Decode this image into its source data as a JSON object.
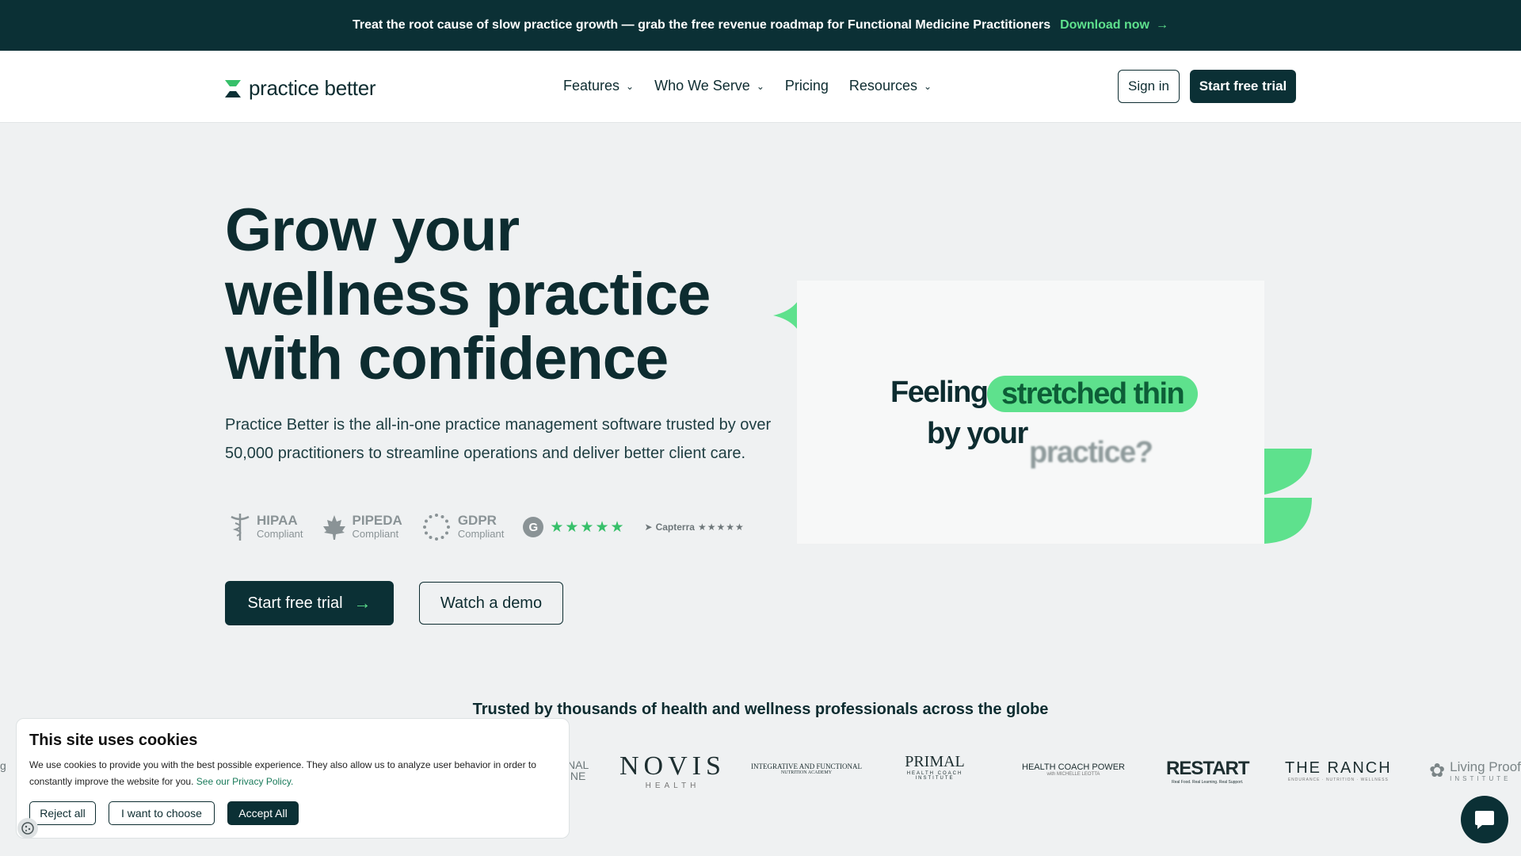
{
  "banner": {
    "text": "Treat the root cause of slow practice growth — grab the free revenue roadmap for Functional Medicine Practitioners",
    "link_label": "Download now"
  },
  "nav": {
    "logo_text": "practice better",
    "menu": [
      {
        "label": "Features",
        "has_dropdown": true
      },
      {
        "label": "Who We Serve",
        "has_dropdown": true
      },
      {
        "label": "Pricing",
        "has_dropdown": false
      },
      {
        "label": "Resources",
        "has_dropdown": true
      }
    ],
    "sign_in": "Sign in",
    "start_trial": "Start free trial"
  },
  "hero": {
    "title_line1": "Grow your",
    "title_line2": "wellness practice",
    "title_line3": "with confidence",
    "description": "Practice Better is the all-in-one practice management software trusted by over 50,000 practitioners to streamline operations and deliver better client care.",
    "badges": [
      {
        "title": "HIPAA",
        "subtitle": "Compliant",
        "icon": "caduceus-icon"
      },
      {
        "title": "PIPEDA",
        "subtitle": "Compliant",
        "icon": "maple-leaf-icon"
      },
      {
        "title": "GDPR",
        "subtitle": "Compliant",
        "icon": "eu-stars-icon"
      }
    ],
    "g2_letter": "G",
    "g2_stars": "★★★★★",
    "capterra_label": "Capterra",
    "capterra_stars": "★★★★★",
    "cta_primary": "Start free trial",
    "cta_secondary": "Watch a demo"
  },
  "media": {
    "word_feeling": "Feeling",
    "highlight": "stretched thin",
    "word_byyour": "by your",
    "word_practice": "practice?"
  },
  "trusted": {
    "heading": "Trusted by thousands of health and wellness professionals across the globe",
    "logos": [
      {
        "main": "NOVIS",
        "sub": "HEALTH"
      },
      {
        "main": "INTEGRATIVE AND FUNCTIONAL",
        "sub": "NUTRITION ACADEMY"
      },
      {
        "main": "PRIMAL",
        "sub": "HEALTH COACH INSTITUTE"
      },
      {
        "main": "HEALTH COACH POWER",
        "sub": "with MICHELLE LEOTTA"
      },
      {
        "main": "RESTART",
        "sub": "Real Food. Real Learning. Real Support."
      },
      {
        "main": "THE RANCH",
        "sub": "ENDURANCE · NUTRITION · WELLNESS"
      },
      {
        "main": "Living Proof",
        "sub": "INSTITUTE"
      }
    ]
  },
  "cookie": {
    "title": "This site uses cookies",
    "body": "We use cookies to provide you with the best possible experience. They also allow us to analyze user behavior in order to constantly improve the website for you.",
    "policy_link": "See our Privacy Policy.",
    "reject": "Reject all",
    "choose": "I want to choose",
    "accept": "Accept All"
  },
  "colors": {
    "brand_dark": "#0b3035",
    "brand_green": "#5ee18d",
    "page_bg": "#eff1f2"
  }
}
